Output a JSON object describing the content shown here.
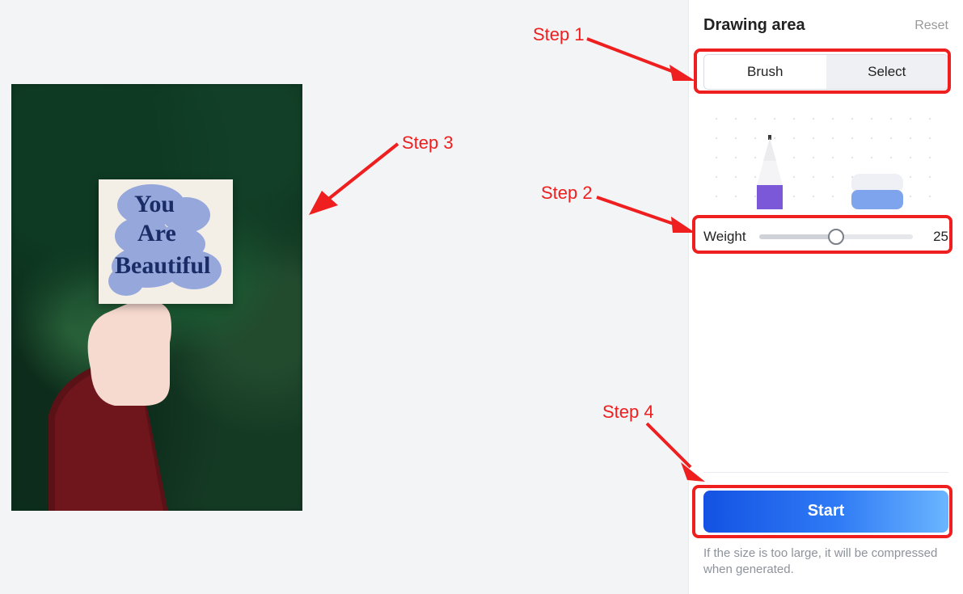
{
  "panel": {
    "title": "Drawing area",
    "reset": "Reset",
    "mode": {
      "brush": "Brush",
      "select": "Select",
      "active": "brush"
    },
    "weight": {
      "label": "Weight",
      "value": "25"
    },
    "start": "Start",
    "hint": "If the size is too large, it will be compressed when generated."
  },
  "image": {
    "note_lines": [
      "You",
      "Are",
      "Beautiful"
    ]
  },
  "annotations": {
    "step1": "Step 1",
    "step2": "Step 2",
    "step3": "Step 3",
    "step4": "Step 4"
  }
}
